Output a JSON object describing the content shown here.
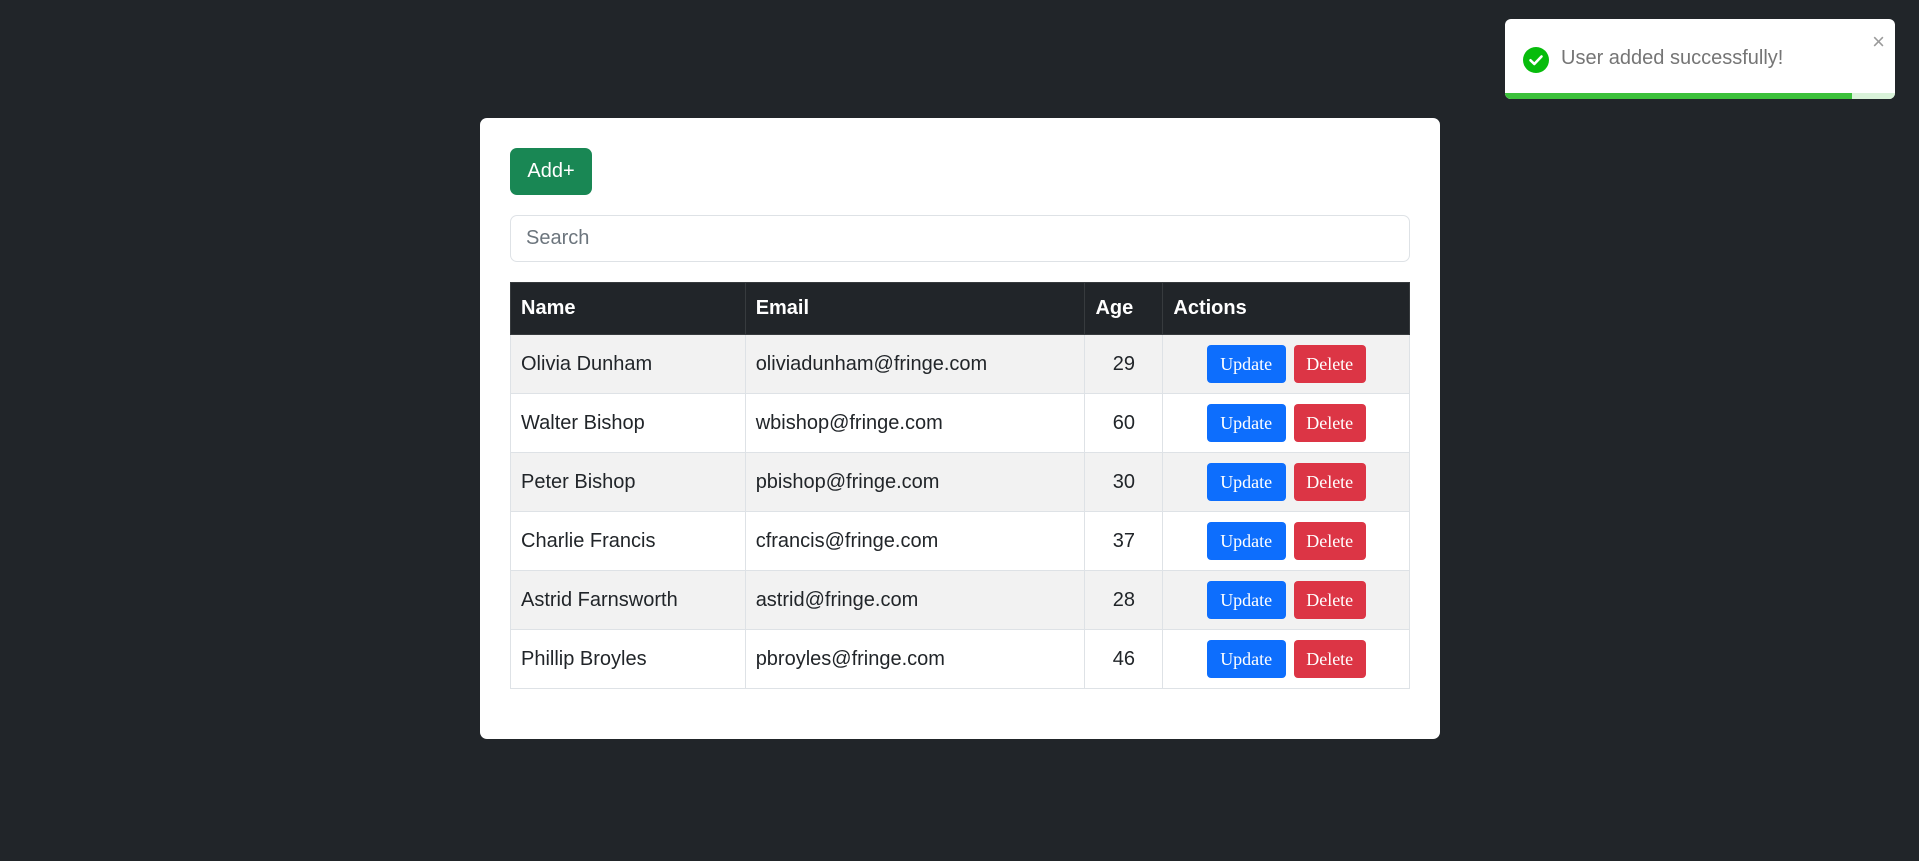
{
  "toolbar": {
    "add_label": "Add+"
  },
  "search": {
    "placeholder": "Search",
    "value": ""
  },
  "table": {
    "headers": {
      "name": "Name",
      "email": "Email",
      "age": "Age",
      "actions": "Actions"
    },
    "rows": [
      {
        "name": "Olivia Dunham",
        "email": "oliviadunham@fringe.com",
        "age": "29"
      },
      {
        "name": "Walter Bishop",
        "email": "wbishop@fringe.com",
        "age": "60"
      },
      {
        "name": "Peter Bishop",
        "email": "pbishop@fringe.com",
        "age": "30"
      },
      {
        "name": "Charlie Francis",
        "email": "cfrancis@fringe.com",
        "age": "37"
      },
      {
        "name": "Astrid Farnsworth",
        "email": "astrid@fringe.com",
        "age": "28"
      },
      {
        "name": "Phillip Broyles",
        "email": "pbroyles@fringe.com",
        "age": "46"
      }
    ],
    "update_label": "Update",
    "delete_label": "Delete"
  },
  "toast": {
    "message": "User added successfully!",
    "close_glyph": "×",
    "icon": "check-circle-icon",
    "progress_fraction": 0.89,
    "colors": {
      "success": "#3cc13b",
      "track": "#d9f2d9"
    }
  },
  "colors": {
    "background": "#212529",
    "add_button": "#198754",
    "update_button": "#0d6efd",
    "delete_button": "#dc3545",
    "table_header": "#212529"
  }
}
